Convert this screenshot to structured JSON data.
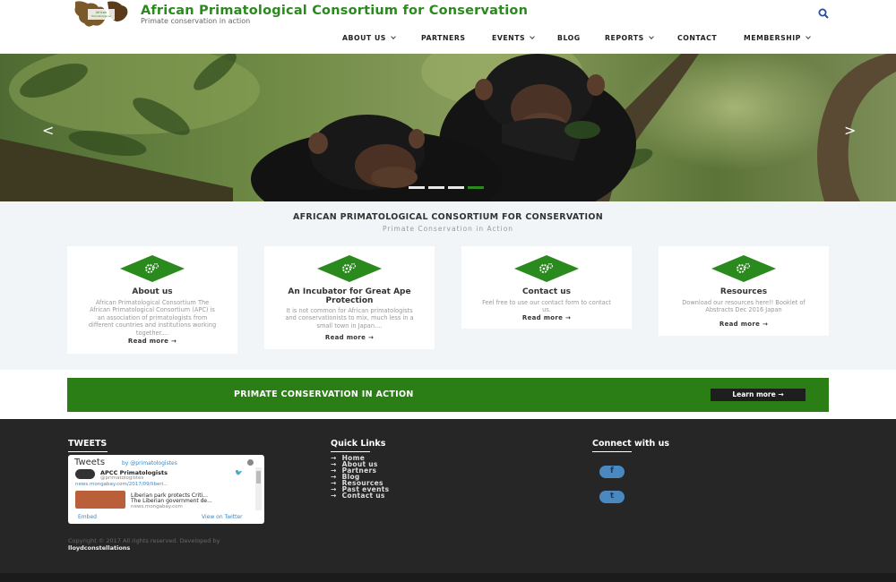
{
  "site": {
    "title": "African Primatological Consortium for Conservation",
    "tagline": "Primate conservation in action"
  },
  "nav": [
    {
      "label": "ABOUT US",
      "has_dropdown": true
    },
    {
      "label": "PARTNERS",
      "has_dropdown": false
    },
    {
      "label": "EVENTS",
      "has_dropdown": true
    },
    {
      "label": "BLOG",
      "has_dropdown": false
    },
    {
      "label": "REPORTS",
      "has_dropdown": true
    },
    {
      "label": "CONTACT",
      "has_dropdown": false
    },
    {
      "label": "MEMBERSHIP",
      "has_dropdown": true
    }
  ],
  "search_icon": "search-icon",
  "hero": {
    "prev": "<",
    "next": ">",
    "slide_count": 4,
    "active_slide": 4
  },
  "intro": {
    "title": "AFRICAN PRIMATOLOGICAL CONSORTIUM FOR CONSERVATION",
    "subtitle": "Primate Conservation in Action"
  },
  "cards": [
    {
      "icon": "gears-icon",
      "title": "About us",
      "text": "African Primatological Consortium The African Primatological Consortium (APC) is an association of primatologists from different countries and institutions working together....",
      "link": "Read more →"
    },
    {
      "icon": "gears-icon",
      "title": "An Incubator for Great Ape Protection",
      "text": "It is not common for African primatologists and conservationists to mix, much less in a small town in Japan....",
      "link": "Read more →"
    },
    {
      "icon": "gears-icon",
      "title": "Contact us",
      "text": "Feel free to use our contact form to contact us.",
      "link": "Read more →"
    },
    {
      "icon": "gears-icon",
      "title": "Resources",
      "text": "Download our resources here!! Booklet of Abstracts Dec 2016 Japan",
      "link": "Read more →"
    }
  ],
  "cta": {
    "text": "PRIMATE CONSERVATION IN ACTION",
    "button": "Learn more →"
  },
  "footer": {
    "tweets_heading": "TWEETS",
    "quicklinks_heading": "Quick Links",
    "connect_heading": "Connect with us",
    "tweets": {
      "title": "Tweets",
      "by": "by @primatologistes",
      "name": "APCC Primatologists",
      "handle": "@primatologistes",
      "link": "news.mongabay.com/2017/09/liberi...",
      "card_title": "Liberian park protects Criti...",
      "card_desc": "The Liberian government de...",
      "card_source": "news.mongabay.com",
      "embed": "Embed",
      "view": "View on Twitter"
    },
    "quick_links": [
      "Home",
      "About us",
      "Partners",
      "Blog",
      "Resources",
      "Past events",
      "Contact us"
    ],
    "quick_link_arrow": "→",
    "social": [
      {
        "icon": "facebook-icon",
        "glyph": "f"
      },
      {
        "icon": "twitter-icon",
        "glyph": "t"
      }
    ],
    "copyright": "Copyright © 2017 All rights reserved. Developed by",
    "developer": "lloydconstellations"
  },
  "colors": {
    "brand_green": "#2b8a1e",
    "cta_green": "#2b7d16",
    "footer_bg": "#262626"
  }
}
